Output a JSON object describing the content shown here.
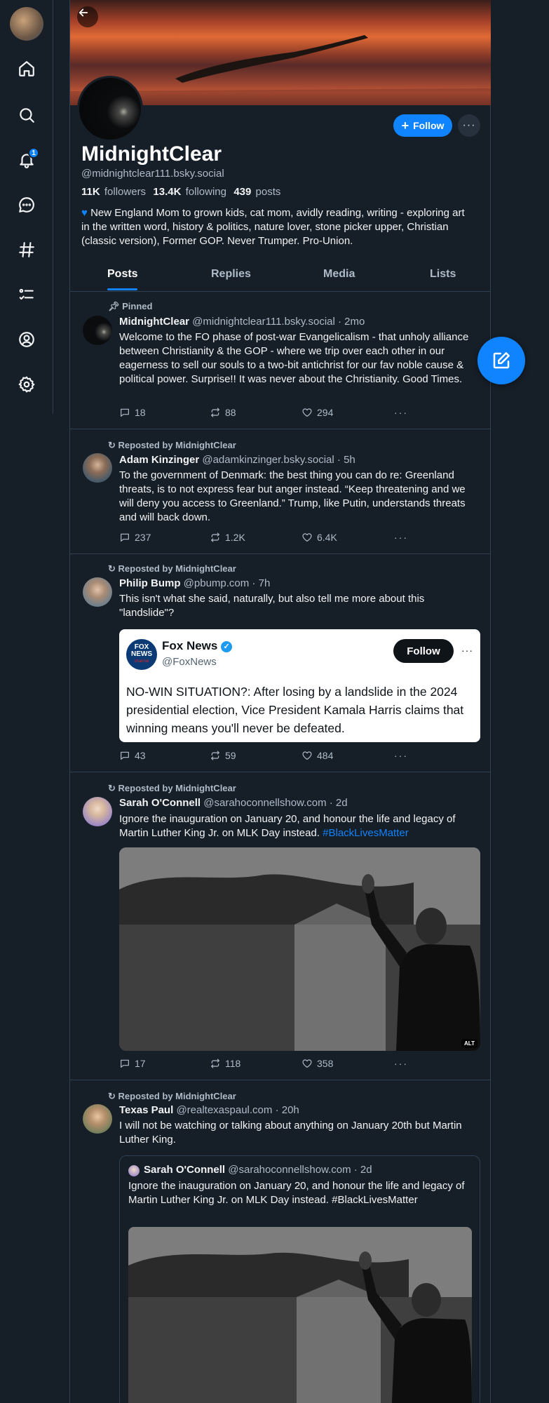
{
  "nav": {
    "notification_count": "1",
    "icons": [
      "home-icon",
      "search-icon",
      "bell-icon",
      "chat-icon",
      "hashtag-icon",
      "list-icon",
      "profile-icon",
      "settings-icon"
    ]
  },
  "profile": {
    "display_name": "MidnightClear",
    "handle": "@midnightclear111.bsky.social",
    "followers_count": "11K",
    "followers_label": "followers",
    "following_count": "13.4K",
    "following_label": "following",
    "posts_count": "439",
    "posts_label": "posts",
    "bio": "New England Mom to grown kids, cat mom, avidly reading, writing - exploring art in the written word, history & politics, nature lover, stone picker upper, Christian (classic version), Former GOP. Never Trumper. Pro-Union.",
    "follow_label": "Follow",
    "more_label": "···"
  },
  "tabs": [
    "Posts",
    "Replies",
    "Media",
    "Lists"
  ],
  "posts": [
    {
      "context": "Pinned",
      "name": "MidnightClear",
      "handle": "@midnightclear111.bsky.social",
      "time": "· 2mo",
      "text": "Welcome to the FO phase of post-war Evangelicalism - that unholy alliance between Christianity & the GOP - where we trip over each other in our eagerness to sell our souls to a two-bit antichrist for our fav noble cause & political power. Surprise!! It was never about the Christianity. Good Times.",
      "replies": "18",
      "reposts": "88",
      "likes": "294"
    },
    {
      "context": "Reposted by MidnightClear",
      "name": "Adam Kinzinger",
      "handle": "@adamkinzinger.bsky.social",
      "time": "· 5h",
      "text": "To the government of Denmark: the best thing you can do re: Greenland threats, is to not express fear but anger instead.  “Keep threatening and we will deny you access to Greenland.”  Trump, like Putin, understands threats and will back down.",
      "replies": "237",
      "reposts": "1.2K",
      "likes": "6.4K"
    },
    {
      "context": "Reposted by MidnightClear",
      "name": "Philip Bump",
      "handle": "@pbump.com",
      "time": "· 7h",
      "text": "This isn't what she said, naturally, but also tell me more about this \"landslide\"?",
      "embed": {
        "logo_line1": "FOX",
        "logo_line2": "NEWS",
        "logo_line3": "channel",
        "name": "Fox News",
        "handle": "@FoxNews",
        "follow_label": "Follow",
        "text": "NO-WIN SITUATION?: After losing by a landslide in the 2024 presidential election, Vice President Kamala Harris claims that winning means you'll never be defeated."
      },
      "replies": "43",
      "reposts": "59",
      "likes": "484"
    },
    {
      "context": "Reposted by MidnightClear",
      "name": "Sarah O'Connell",
      "handle": "@sarahoconnellshow.com",
      "time": "· 2d",
      "text": "Ignore the inauguration on January 20, and honour the life and legacy of Martin Luther King Jr. on MLK Day instead.",
      "hashtag": "#BlackLivesMatter",
      "alt": "ALT",
      "replies": "17",
      "reposts": "118",
      "likes": "358"
    },
    {
      "context": "Reposted by MidnightClear",
      "name": "Texas Paul",
      "handle": "@realtexaspaul.com",
      "time": "· 20h",
      "text": "I will not be watching or talking about anything on January 20th but Martin Luther King.",
      "quote": {
        "name": "Sarah O'Connell",
        "handle": "@sarahoconnellshow.com",
        "time": "· 2d",
        "text": "Ignore the inauguration on January 20, and honour the life and legacy of Martin Luther King Jr. on MLK Day instead. #BlackLivesMatter"
      }
    }
  ],
  "colors": {
    "background": "#161e27",
    "accent": "#1083fe",
    "border": "#2e4052",
    "muted": "#aebbc9"
  }
}
